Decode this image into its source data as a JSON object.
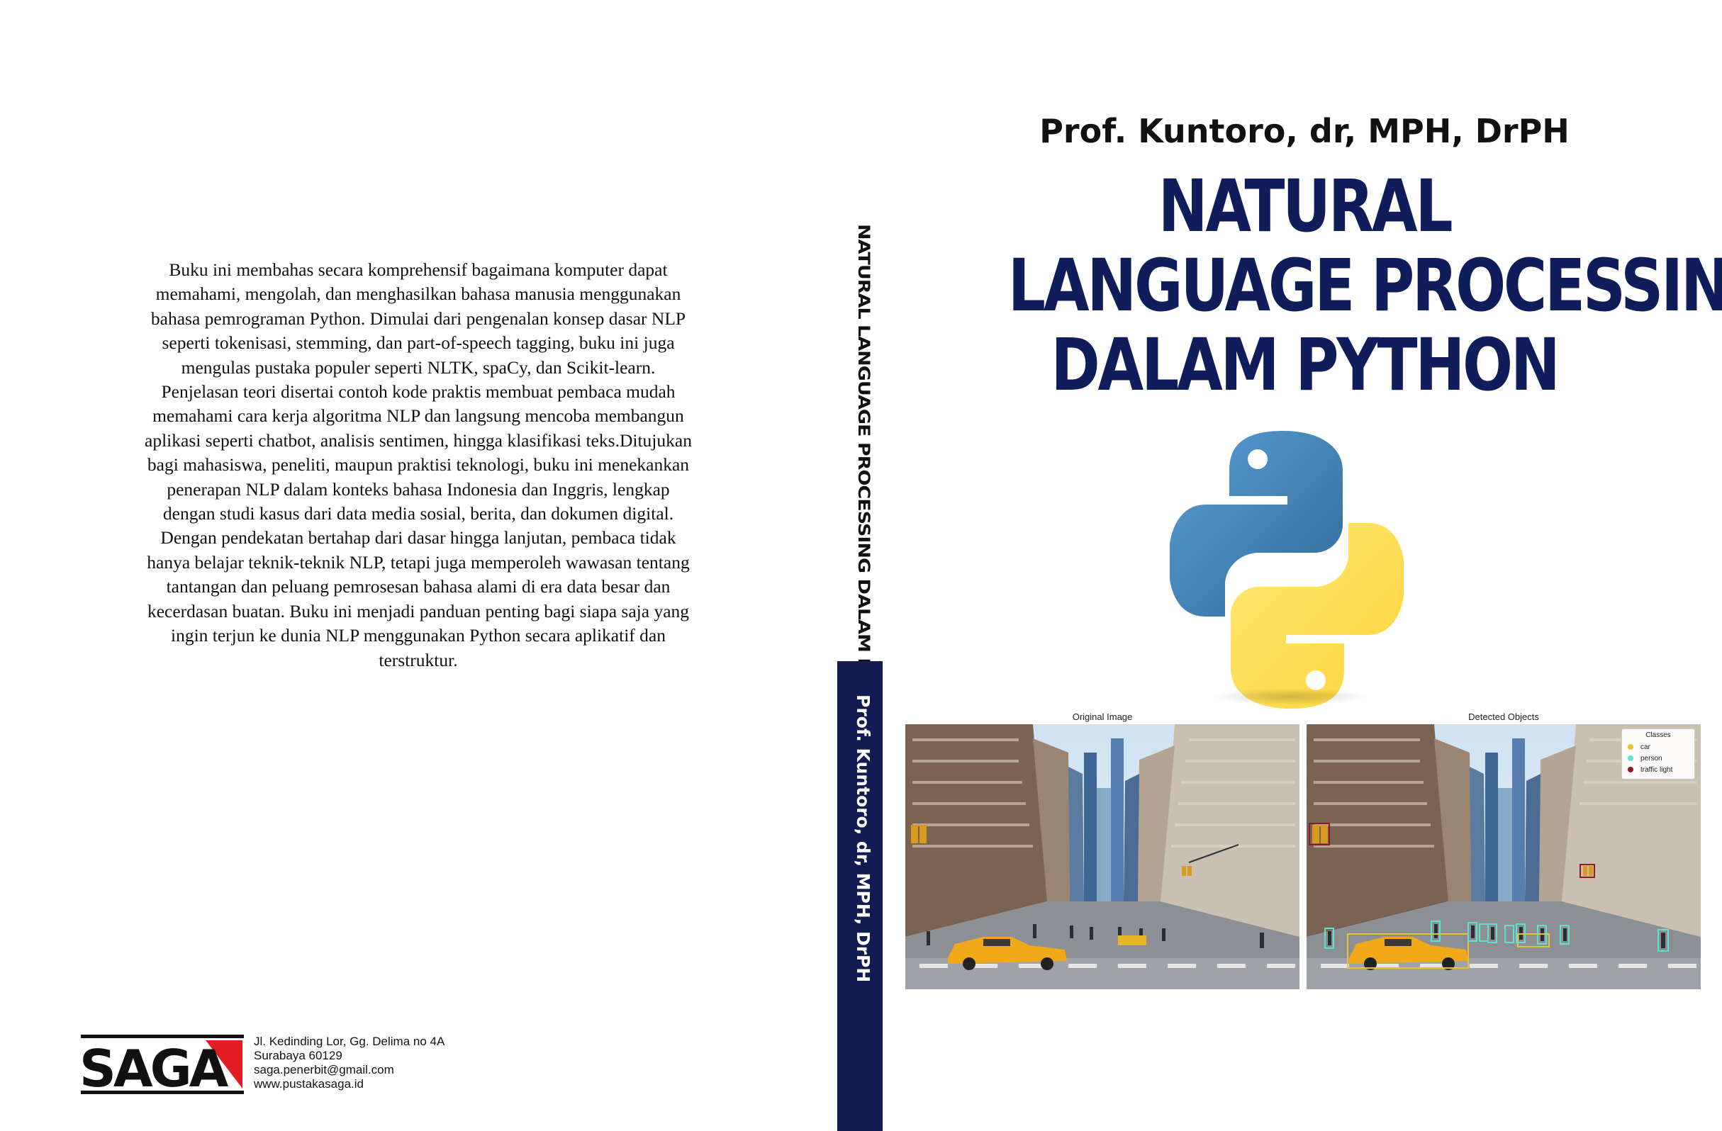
{
  "back_cover": {
    "blurb_lines": [
      "Buku ini membahas secara komprehensif bagaimana komputer dapat",
      "memahami, mengolah, dan menghasilkan bahasa manusia menggunakan",
      "bahasa pemrograman Python. Dimulai dari pengenalan konsep dasar NLP",
      "seperti tokenisasi, stemming, dan part-of-speech tagging, buku ini juga",
      "mengulas pustaka populer seperti NLTK, spaCy, dan Scikit-learn.",
      "Penjelasan teori disertai contoh kode praktis membuat pembaca mudah",
      "memahami cara kerja algoritma NLP dan langsung mencoba membangun",
      "aplikasi seperti chatbot, analisis sentimen, hingga klasifikasi teks.Ditujukan",
      "bagi mahasiswa, peneliti, maupun praktisi teknologi, buku ini menekankan",
      "penerapan NLP dalam konteks bahasa Indonesia dan Inggris, lengkap",
      "dengan studi kasus dari data media sosial, berita, dan dokumen digital.",
      "Dengan pendekatan bertahap dari dasar hingga lanjutan, pembaca tidak",
      "hanya belajar teknik-teknik NLP, tetapi juga memperoleh wawasan tentang",
      "tantangan dan peluang pemrosesan bahasa alami di era data besar dan",
      "kecerdasan buatan. Buku ini menjadi panduan penting bagi siapa saja yang",
      "ingin terjun ke dunia NLP menggunakan Python secara aplikatif dan",
      "terstruktur."
    ],
    "publisher": {
      "logo_text": "SAGA",
      "address_lines": [
        "Jl. Kedinding Lor, Gg. Delima no 4A",
        "Surabaya 60129",
        "saga.penerbit@gmail.com",
        "www.pustakasaga.id"
      ]
    }
  },
  "spine": {
    "title": "NATURAL LANGUAGE PROCESSING DALAM PYTHON",
    "author": "Prof. Kuntoro, dr, MPH, DrPH"
  },
  "front_cover": {
    "author": "Prof. Kuntoro, dr, MPH, DrPH",
    "title_lines": [
      "NATURAL",
      "LANGUAGE PROCESSING",
      "DALAM PYTHON"
    ],
    "figure_left_caption": "Original Image",
    "figure_right_caption": "Detected Objects",
    "legend": {
      "title": "Classes",
      "items": [
        {
          "label": "car",
          "color": "#e8c33a"
        },
        {
          "label": "person",
          "color": "#5fe0d0"
        },
        {
          "label": "traffic light",
          "color": "#8b1a2b"
        }
      ]
    }
  },
  "colors": {
    "title_navy": "#0f1e5a",
    "spine_navy": "#111d52",
    "python_blue": "#3774c4",
    "python_yellow": "#fdd63a"
  }
}
